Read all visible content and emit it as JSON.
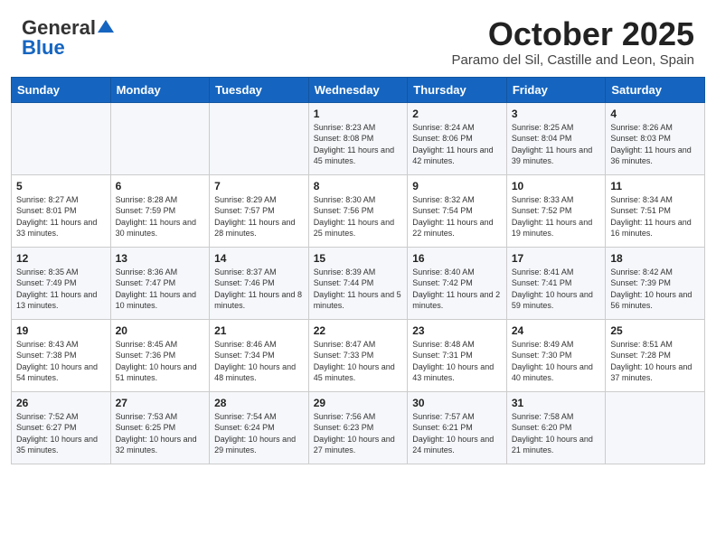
{
  "header": {
    "logo_general": "General",
    "logo_blue": "Blue",
    "month": "October 2025",
    "location": "Paramo del Sil, Castille and Leon, Spain"
  },
  "days_of_week": [
    "Sunday",
    "Monday",
    "Tuesday",
    "Wednesday",
    "Thursday",
    "Friday",
    "Saturday"
  ],
  "weeks": [
    [
      {
        "day": "",
        "info": ""
      },
      {
        "day": "",
        "info": ""
      },
      {
        "day": "",
        "info": ""
      },
      {
        "day": "1",
        "info": "Sunrise: 8:23 AM\nSunset: 8:08 PM\nDaylight: 11 hours and 45 minutes."
      },
      {
        "day": "2",
        "info": "Sunrise: 8:24 AM\nSunset: 8:06 PM\nDaylight: 11 hours and 42 minutes."
      },
      {
        "day": "3",
        "info": "Sunrise: 8:25 AM\nSunset: 8:04 PM\nDaylight: 11 hours and 39 minutes."
      },
      {
        "day": "4",
        "info": "Sunrise: 8:26 AM\nSunset: 8:03 PM\nDaylight: 11 hours and 36 minutes."
      }
    ],
    [
      {
        "day": "5",
        "info": "Sunrise: 8:27 AM\nSunset: 8:01 PM\nDaylight: 11 hours and 33 minutes."
      },
      {
        "day": "6",
        "info": "Sunrise: 8:28 AM\nSunset: 7:59 PM\nDaylight: 11 hours and 30 minutes."
      },
      {
        "day": "7",
        "info": "Sunrise: 8:29 AM\nSunset: 7:57 PM\nDaylight: 11 hours and 28 minutes."
      },
      {
        "day": "8",
        "info": "Sunrise: 8:30 AM\nSunset: 7:56 PM\nDaylight: 11 hours and 25 minutes."
      },
      {
        "day": "9",
        "info": "Sunrise: 8:32 AM\nSunset: 7:54 PM\nDaylight: 11 hours and 22 minutes."
      },
      {
        "day": "10",
        "info": "Sunrise: 8:33 AM\nSunset: 7:52 PM\nDaylight: 11 hours and 19 minutes."
      },
      {
        "day": "11",
        "info": "Sunrise: 8:34 AM\nSunset: 7:51 PM\nDaylight: 11 hours and 16 minutes."
      }
    ],
    [
      {
        "day": "12",
        "info": "Sunrise: 8:35 AM\nSunset: 7:49 PM\nDaylight: 11 hours and 13 minutes."
      },
      {
        "day": "13",
        "info": "Sunrise: 8:36 AM\nSunset: 7:47 PM\nDaylight: 11 hours and 10 minutes."
      },
      {
        "day": "14",
        "info": "Sunrise: 8:37 AM\nSunset: 7:46 PM\nDaylight: 11 hours and 8 minutes."
      },
      {
        "day": "15",
        "info": "Sunrise: 8:39 AM\nSunset: 7:44 PM\nDaylight: 11 hours and 5 minutes."
      },
      {
        "day": "16",
        "info": "Sunrise: 8:40 AM\nSunset: 7:42 PM\nDaylight: 11 hours and 2 minutes."
      },
      {
        "day": "17",
        "info": "Sunrise: 8:41 AM\nSunset: 7:41 PM\nDaylight: 10 hours and 59 minutes."
      },
      {
        "day": "18",
        "info": "Sunrise: 8:42 AM\nSunset: 7:39 PM\nDaylight: 10 hours and 56 minutes."
      }
    ],
    [
      {
        "day": "19",
        "info": "Sunrise: 8:43 AM\nSunset: 7:38 PM\nDaylight: 10 hours and 54 minutes."
      },
      {
        "day": "20",
        "info": "Sunrise: 8:45 AM\nSunset: 7:36 PM\nDaylight: 10 hours and 51 minutes."
      },
      {
        "day": "21",
        "info": "Sunrise: 8:46 AM\nSunset: 7:34 PM\nDaylight: 10 hours and 48 minutes."
      },
      {
        "day": "22",
        "info": "Sunrise: 8:47 AM\nSunset: 7:33 PM\nDaylight: 10 hours and 45 minutes."
      },
      {
        "day": "23",
        "info": "Sunrise: 8:48 AM\nSunset: 7:31 PM\nDaylight: 10 hours and 43 minutes."
      },
      {
        "day": "24",
        "info": "Sunrise: 8:49 AM\nSunset: 7:30 PM\nDaylight: 10 hours and 40 minutes."
      },
      {
        "day": "25",
        "info": "Sunrise: 8:51 AM\nSunset: 7:28 PM\nDaylight: 10 hours and 37 minutes."
      }
    ],
    [
      {
        "day": "26",
        "info": "Sunrise: 7:52 AM\nSunset: 6:27 PM\nDaylight: 10 hours and 35 minutes."
      },
      {
        "day": "27",
        "info": "Sunrise: 7:53 AM\nSunset: 6:25 PM\nDaylight: 10 hours and 32 minutes."
      },
      {
        "day": "28",
        "info": "Sunrise: 7:54 AM\nSunset: 6:24 PM\nDaylight: 10 hours and 29 minutes."
      },
      {
        "day": "29",
        "info": "Sunrise: 7:56 AM\nSunset: 6:23 PM\nDaylight: 10 hours and 27 minutes."
      },
      {
        "day": "30",
        "info": "Sunrise: 7:57 AM\nSunset: 6:21 PM\nDaylight: 10 hours and 24 minutes."
      },
      {
        "day": "31",
        "info": "Sunrise: 7:58 AM\nSunset: 6:20 PM\nDaylight: 10 hours and 21 minutes."
      },
      {
        "day": "",
        "info": ""
      }
    ]
  ]
}
